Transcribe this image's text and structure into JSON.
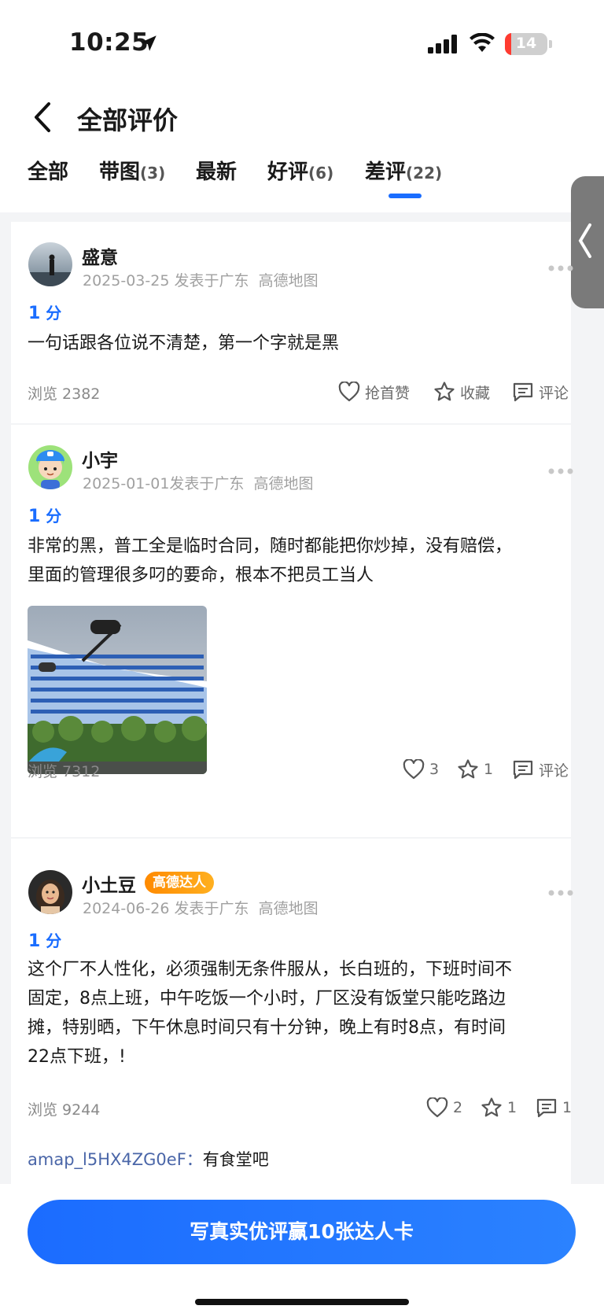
{
  "status_bar": {
    "time": "10:25",
    "battery": "14",
    "battery_level": 0.14
  },
  "header": {
    "title": "全部评价"
  },
  "tabs": [
    {
      "label": "全部",
      "count": ""
    },
    {
      "label": "带图",
      "count": "(3)"
    },
    {
      "label": "最新",
      "count": ""
    },
    {
      "label": "好评",
      "count": "(6)"
    },
    {
      "label": "差评",
      "count": "(22)",
      "active": true
    }
  ],
  "reviews": [
    {
      "user": "盛意",
      "date": "2025-03-25",
      "published": "发表于广东",
      "source": "高德地图",
      "score": "1",
      "score_unit": "分",
      "text": "一句话跟各位说不清楚，第一个字就是黑",
      "views_label": "浏览 2382",
      "like_label": "抢首赞",
      "fav_label": "收藏",
      "comment_label": "评论"
    },
    {
      "user": "小宇",
      "date": "2025-01-01",
      "published": "发表于广东",
      "source": "高德地图",
      "score": "1",
      "score_unit": "分",
      "text_lines": [
        "非常的黑，普工全是临时合同，随时都能把你炒掉，没有赔偿，",
        "里面的管理很多叼的要命，根本不把员工当人"
      ],
      "views_label": "浏览 7312",
      "like_label": "3",
      "fav_label": "1",
      "comment_label": "评论"
    },
    {
      "user": "小土豆",
      "badge": "高德达人",
      "date": "2024-06-26",
      "published": "发表于广东",
      "source": "高德地图",
      "score": "1",
      "score_unit": "分",
      "text_lines": [
        "这个厂不人性化，必须强制无条件服从，长白班的，下班时间不",
        "固定，8点上班，中午吃饭一个小时，厂区没有饭堂只能吃路边",
        "摊，特别晒，下午休息时间只有十分钟，晚上有时8点，有时间",
        "22点下班，!"
      ],
      "views_label": "浏览 9244",
      "like_label": "2",
      "fav_label": "1",
      "comment_label": "1",
      "reply": {
        "user": "amap_l5HX4ZG0eF",
        "colon": "：",
        "text": "有食堂吧"
      }
    }
  ],
  "cta": {
    "label": "写真实优评赢10张达人卡"
  },
  "colors": {
    "accent": "#1a6dff",
    "badge": "#ff8a00",
    "reply_user": "#4a66a8"
  }
}
